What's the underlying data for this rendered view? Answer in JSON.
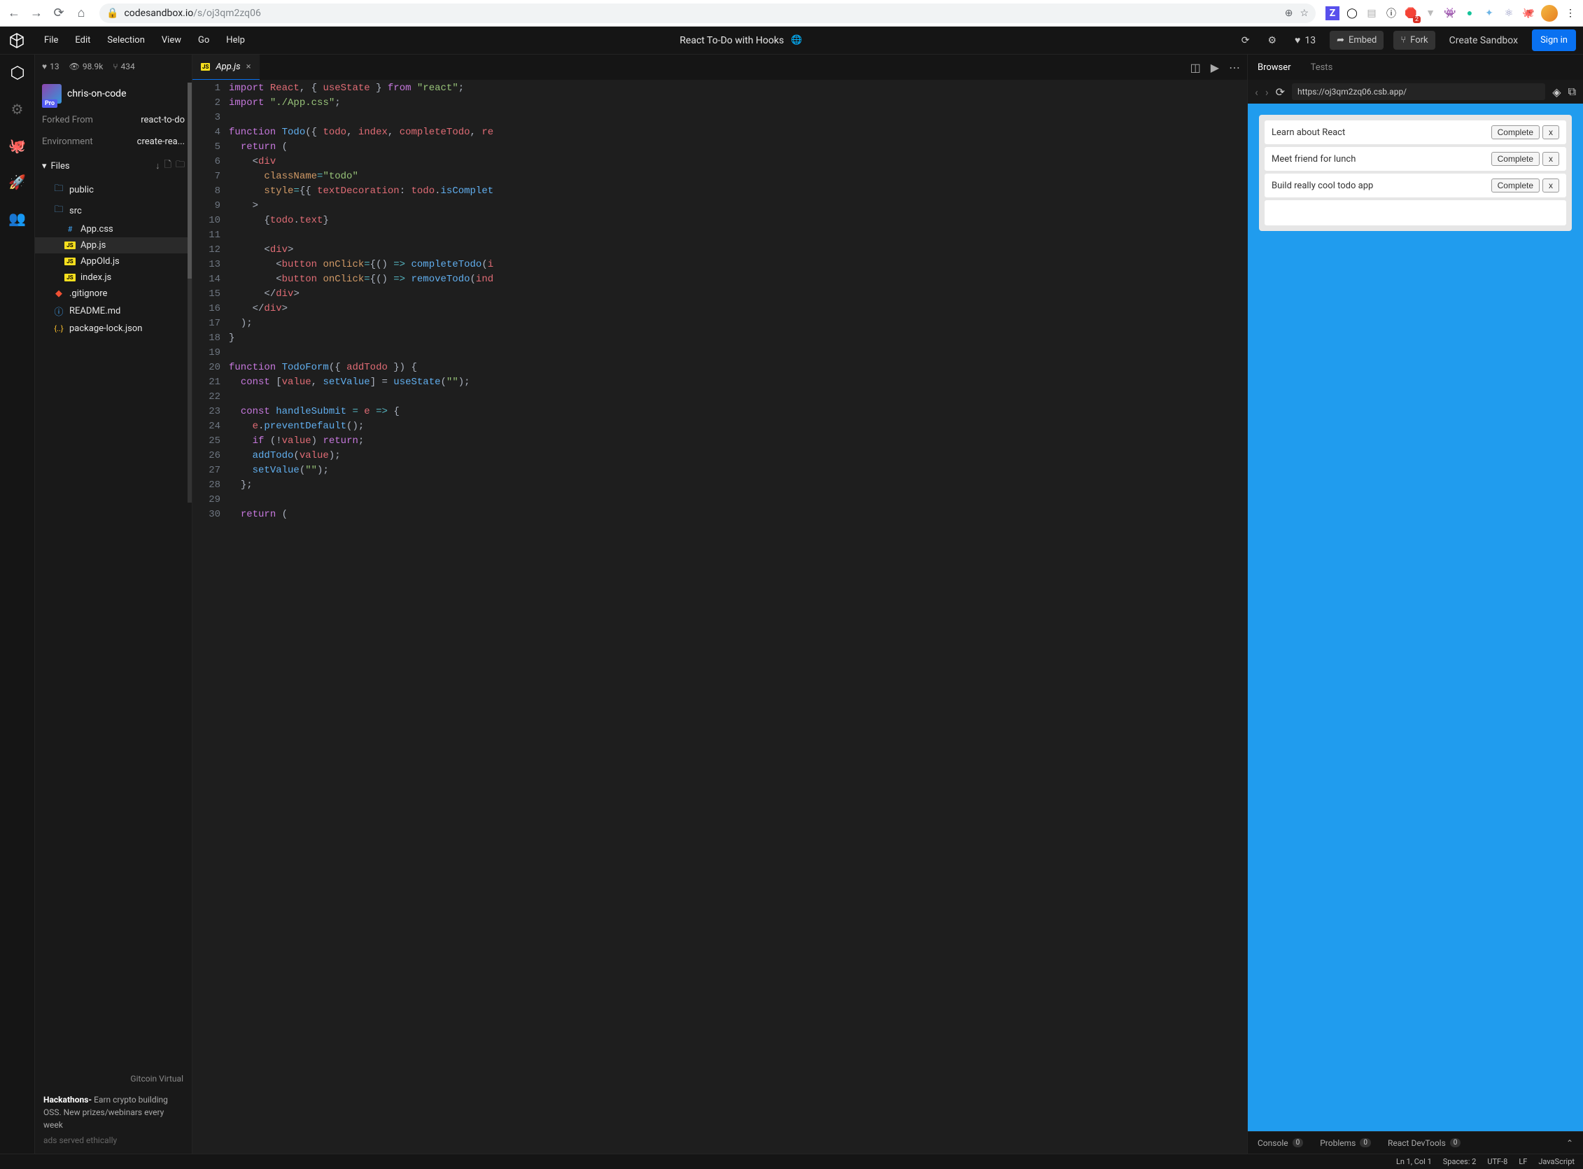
{
  "browser": {
    "url_domain": "codesandbox.io",
    "url_path": "/s/oj3qm2zq06",
    "ext_badge": "2"
  },
  "menubar": {
    "items": [
      "File",
      "Edit",
      "Selection",
      "View",
      "Go",
      "Help"
    ],
    "title": "React To-Do with Hooks",
    "likes": "13",
    "embed": "Embed",
    "fork": "Fork",
    "create": "Create Sandbox",
    "signin": "Sign in"
  },
  "sidebar": {
    "stats_likes": "13",
    "stats_views": "98.9k",
    "stats_forks": "434",
    "owner": "chris-on-code",
    "owner_badge": "Pro",
    "forked_label": "Forked From",
    "forked_val": "react-to-do",
    "env_label": "Environment",
    "env_val": "create-rea...",
    "files_header": "Files",
    "files": [
      {
        "name": "public",
        "type": "folder",
        "indent": 1
      },
      {
        "name": "src",
        "type": "folder",
        "indent": 1
      },
      {
        "name": "App.css",
        "type": "css",
        "indent": 2
      },
      {
        "name": "App.js",
        "type": "js",
        "indent": 2,
        "selected": true
      },
      {
        "name": "AppOld.js",
        "type": "js",
        "indent": 2
      },
      {
        "name": "index.js",
        "type": "js",
        "indent": 2
      },
      {
        "name": ".gitignore",
        "type": "git",
        "indent": 1
      },
      {
        "name": "README.md",
        "type": "info",
        "indent": 1
      },
      {
        "name": "package-lock.json",
        "type": "json",
        "indent": 1
      }
    ],
    "ad_title": "Gitcoin Virtual",
    "ad_body": "Hackathons- Earn crypto building OSS. New prizes/webinars every week",
    "ad_footer": "ads served ethically"
  },
  "editor": {
    "tab_filename": "App.js",
    "lines": [
      [
        {
          "c": "tk-keyword",
          "t": "import"
        },
        {
          "c": "",
          "t": " "
        },
        {
          "c": "tk-var",
          "t": "React"
        },
        {
          "c": "tk-punct",
          "t": ", { "
        },
        {
          "c": "tk-var",
          "t": "useState"
        },
        {
          "c": "tk-punct",
          "t": " } "
        },
        {
          "c": "tk-keyword",
          "t": "from"
        },
        {
          "c": "",
          "t": " "
        },
        {
          "c": "tk-string",
          "t": "\"react\""
        },
        {
          "c": "tk-punct",
          "t": ";"
        }
      ],
      [
        {
          "c": "tk-keyword",
          "t": "import"
        },
        {
          "c": "",
          "t": " "
        },
        {
          "c": "tk-string",
          "t": "\"./App.css\""
        },
        {
          "c": "tk-punct",
          "t": ";"
        }
      ],
      [],
      [
        {
          "c": "tk-keyword",
          "t": "function"
        },
        {
          "c": "",
          "t": " "
        },
        {
          "c": "tk-def",
          "t": "Todo"
        },
        {
          "c": "tk-punct",
          "t": "({ "
        },
        {
          "c": "tk-var",
          "t": "todo"
        },
        {
          "c": "tk-punct",
          "t": ", "
        },
        {
          "c": "tk-var",
          "t": "index"
        },
        {
          "c": "tk-punct",
          "t": ", "
        },
        {
          "c": "tk-var",
          "t": "completeTodo"
        },
        {
          "c": "tk-punct",
          "t": ", "
        },
        {
          "c": "tk-var",
          "t": "re"
        }
      ],
      [
        {
          "c": "",
          "t": "  "
        },
        {
          "c": "tk-keyword",
          "t": "return"
        },
        {
          "c": "tk-punct",
          "t": " ("
        }
      ],
      [
        {
          "c": "",
          "t": "    "
        },
        {
          "c": "tk-punct",
          "t": "<"
        },
        {
          "c": "tk-tag",
          "t": "div"
        }
      ],
      [
        {
          "c": "",
          "t": "      "
        },
        {
          "c": "tk-attr",
          "t": "className"
        },
        {
          "c": "tk-op",
          "t": "="
        },
        {
          "c": "tk-string",
          "t": "\"todo\""
        }
      ],
      [
        {
          "c": "",
          "t": "      "
        },
        {
          "c": "tk-attr",
          "t": "style"
        },
        {
          "c": "tk-op",
          "t": "="
        },
        {
          "c": "tk-punct",
          "t": "{{ "
        },
        {
          "c": "tk-var",
          "t": "textDecoration"
        },
        {
          "c": "tk-punct",
          "t": ": "
        },
        {
          "c": "tk-var",
          "t": "todo"
        },
        {
          "c": "tk-punct",
          "t": "."
        },
        {
          "c": "tk-fn",
          "t": "isComplet"
        }
      ],
      [
        {
          "c": "",
          "t": "    "
        },
        {
          "c": "tk-punct",
          "t": ">"
        }
      ],
      [
        {
          "c": "",
          "t": "      "
        },
        {
          "c": "tk-punct",
          "t": "{"
        },
        {
          "c": "tk-var",
          "t": "todo"
        },
        {
          "c": "tk-punct",
          "t": "."
        },
        {
          "c": "tk-var",
          "t": "text"
        },
        {
          "c": "tk-punct",
          "t": "}"
        }
      ],
      [],
      [
        {
          "c": "",
          "t": "      "
        },
        {
          "c": "tk-punct",
          "t": "<"
        },
        {
          "c": "tk-tag",
          "t": "div"
        },
        {
          "c": "tk-punct",
          "t": ">"
        }
      ],
      [
        {
          "c": "",
          "t": "        "
        },
        {
          "c": "tk-punct",
          "t": "<"
        },
        {
          "c": "tk-tag",
          "t": "button"
        },
        {
          "c": "",
          "t": " "
        },
        {
          "c": "tk-attr",
          "t": "onClick"
        },
        {
          "c": "tk-op",
          "t": "="
        },
        {
          "c": "tk-punct",
          "t": "{() "
        },
        {
          "c": "tk-op",
          "t": "=>"
        },
        {
          "c": "",
          "t": " "
        },
        {
          "c": "tk-fn",
          "t": "completeTodo"
        },
        {
          "c": "tk-punct",
          "t": "("
        },
        {
          "c": "tk-var",
          "t": "i"
        }
      ],
      [
        {
          "c": "",
          "t": "        "
        },
        {
          "c": "tk-punct",
          "t": "<"
        },
        {
          "c": "tk-tag",
          "t": "button"
        },
        {
          "c": "",
          "t": " "
        },
        {
          "c": "tk-attr",
          "t": "onClick"
        },
        {
          "c": "tk-op",
          "t": "="
        },
        {
          "c": "tk-punct",
          "t": "{() "
        },
        {
          "c": "tk-op",
          "t": "=>"
        },
        {
          "c": "",
          "t": " "
        },
        {
          "c": "tk-fn",
          "t": "removeTodo"
        },
        {
          "c": "tk-punct",
          "t": "("
        },
        {
          "c": "tk-var",
          "t": "ind"
        }
      ],
      [
        {
          "c": "",
          "t": "      "
        },
        {
          "c": "tk-punct",
          "t": "</"
        },
        {
          "c": "tk-tag",
          "t": "div"
        },
        {
          "c": "tk-punct",
          "t": ">"
        }
      ],
      [
        {
          "c": "",
          "t": "    "
        },
        {
          "c": "tk-punct",
          "t": "</"
        },
        {
          "c": "tk-tag",
          "t": "div"
        },
        {
          "c": "tk-punct",
          "t": ">"
        }
      ],
      [
        {
          "c": "",
          "t": "  "
        },
        {
          "c": "tk-punct",
          "t": ");"
        }
      ],
      [
        {
          "c": "tk-punct",
          "t": "}"
        }
      ],
      [],
      [
        {
          "c": "tk-keyword",
          "t": "function"
        },
        {
          "c": "",
          "t": " "
        },
        {
          "c": "tk-def",
          "t": "TodoForm"
        },
        {
          "c": "tk-punct",
          "t": "({ "
        },
        {
          "c": "tk-var",
          "t": "addTodo"
        },
        {
          "c": "tk-punct",
          "t": " }) {"
        }
      ],
      [
        {
          "c": "",
          "t": "  "
        },
        {
          "c": "tk-keyword",
          "t": "const"
        },
        {
          "c": "",
          "t": " "
        },
        {
          "c": "tk-punct",
          "t": "["
        },
        {
          "c": "tk-var",
          "t": "value"
        },
        {
          "c": "tk-punct",
          "t": ", "
        },
        {
          "c": "tk-def",
          "t": "setValue"
        },
        {
          "c": "tk-punct",
          "t": "] = "
        },
        {
          "c": "tk-fn",
          "t": "useState"
        },
        {
          "c": "tk-punct",
          "t": "("
        },
        {
          "c": "tk-string",
          "t": "\"\""
        },
        {
          "c": "tk-punct",
          "t": ");"
        }
      ],
      [],
      [
        {
          "c": "",
          "t": "  "
        },
        {
          "c": "tk-keyword",
          "t": "const"
        },
        {
          "c": "",
          "t": " "
        },
        {
          "c": "tk-def",
          "t": "handleSubmit"
        },
        {
          "c": "",
          "t": " "
        },
        {
          "c": "tk-op",
          "t": "="
        },
        {
          "c": "",
          "t": " "
        },
        {
          "c": "tk-var",
          "t": "e"
        },
        {
          "c": "",
          "t": " "
        },
        {
          "c": "tk-op",
          "t": "=>"
        },
        {
          "c": "",
          "t": " "
        },
        {
          "c": "tk-punct",
          "t": "{"
        }
      ],
      [
        {
          "c": "",
          "t": "    "
        },
        {
          "c": "tk-var",
          "t": "e"
        },
        {
          "c": "tk-punct",
          "t": "."
        },
        {
          "c": "tk-fn",
          "t": "preventDefault"
        },
        {
          "c": "tk-punct",
          "t": "();"
        }
      ],
      [
        {
          "c": "",
          "t": "    "
        },
        {
          "c": "tk-keyword",
          "t": "if"
        },
        {
          "c": "",
          "t": " "
        },
        {
          "c": "tk-punct",
          "t": "(!"
        },
        {
          "c": "tk-var",
          "t": "value"
        },
        {
          "c": "tk-punct",
          "t": ") "
        },
        {
          "c": "tk-keyword",
          "t": "return"
        },
        {
          "c": "tk-punct",
          "t": ";"
        }
      ],
      [
        {
          "c": "",
          "t": "    "
        },
        {
          "c": "tk-fn",
          "t": "addTodo"
        },
        {
          "c": "tk-punct",
          "t": "("
        },
        {
          "c": "tk-var",
          "t": "value"
        },
        {
          "c": "tk-punct",
          "t": ");"
        }
      ],
      [
        {
          "c": "",
          "t": "    "
        },
        {
          "c": "tk-fn",
          "t": "setValue"
        },
        {
          "c": "tk-punct",
          "t": "("
        },
        {
          "c": "tk-string",
          "t": "\"\""
        },
        {
          "c": "tk-punct",
          "t": ");"
        }
      ],
      [
        {
          "c": "",
          "t": "  "
        },
        {
          "c": "tk-punct",
          "t": "};"
        }
      ],
      [],
      [
        {
          "c": "",
          "t": "  "
        },
        {
          "c": "tk-keyword",
          "t": "return"
        },
        {
          "c": "",
          "t": " "
        },
        {
          "c": "tk-punct",
          "t": "("
        }
      ]
    ]
  },
  "preview": {
    "tab_browser": "Browser",
    "tab_tests": "Tests",
    "url": "https://oj3qm2zq06.csb.app/",
    "todos": [
      {
        "text": "Learn about React",
        "complete": "Complete",
        "remove": "x"
      },
      {
        "text": "Meet friend for lunch",
        "complete": "Complete",
        "remove": "x"
      },
      {
        "text": "Build really cool todo app",
        "complete": "Complete",
        "remove": "x"
      }
    ],
    "bottom_tabs": {
      "console": "Console",
      "console_count": "0",
      "problems": "Problems",
      "problems_count": "0",
      "devtools": "React DevTools",
      "devtools_count": "0"
    }
  },
  "statusbar": {
    "pos": "Ln 1, Col 1",
    "spaces": "Spaces: 2",
    "encoding": "UTF-8",
    "eol": "LF",
    "lang": "JavaScript"
  }
}
